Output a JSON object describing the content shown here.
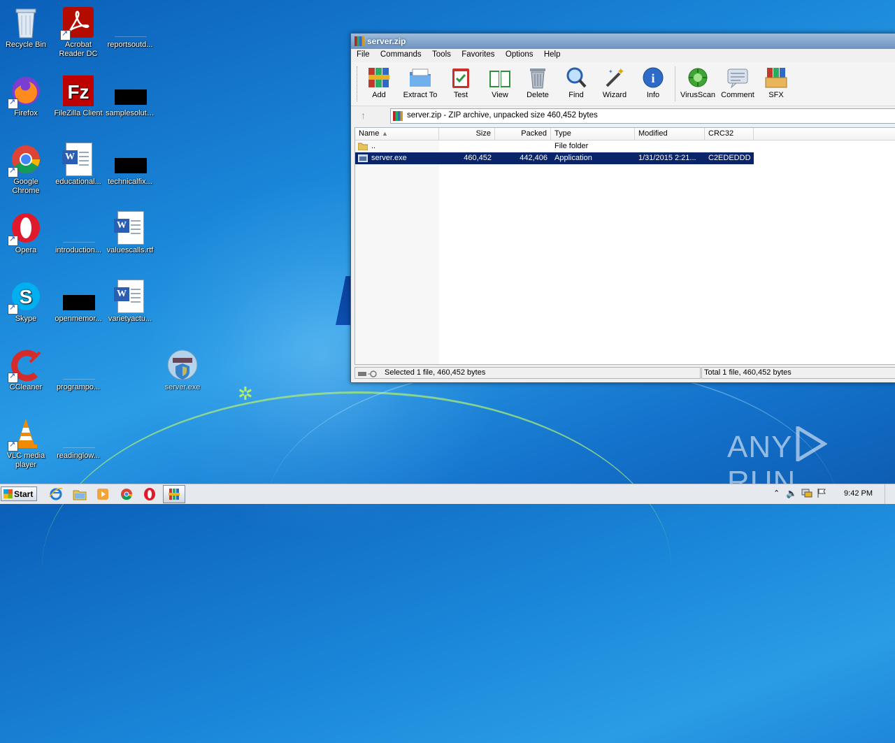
{
  "desktop": {
    "icons": [
      {
        "label": "Recycle Bin"
      },
      {
        "label": "Acrobat Reader DC"
      },
      {
        "label": "reportsoutd..."
      },
      {
        "label": "Firefox"
      },
      {
        "label": "FileZilla Client"
      },
      {
        "label": "samplesoluti..."
      },
      {
        "label": "Google Chrome"
      },
      {
        "label": "educational..."
      },
      {
        "label": "technicalfix..."
      },
      {
        "label": "Opera"
      },
      {
        "label": "introduction..."
      },
      {
        "label": "valuescalls.rtf"
      },
      {
        "label": "Skype"
      },
      {
        "label": "openmemor..."
      },
      {
        "label": "varietyactu..."
      },
      {
        "label": "CCleaner"
      },
      {
        "label": "programpo..."
      },
      {
        "label": "server.exe"
      },
      {
        "label": "VLC media player"
      },
      {
        "label": "readinglow..."
      }
    ]
  },
  "window": {
    "title": "server.zip",
    "menu": [
      "File",
      "Commands",
      "Tools",
      "Favorites",
      "Options",
      "Help"
    ],
    "toolbar": [
      {
        "label": "Add",
        "icon": "add-archive-icon"
      },
      {
        "label": "Extract To",
        "icon": "extract-folder-icon"
      },
      {
        "label": "Test",
        "icon": "test-clipboard-icon"
      },
      {
        "label": "View",
        "icon": "view-book-icon"
      },
      {
        "label": "Delete",
        "icon": "trash-icon"
      },
      {
        "label": "Find",
        "icon": "magnifier-icon"
      },
      {
        "label": "Wizard",
        "icon": "magic-wand-icon"
      },
      {
        "label": "Info",
        "icon": "info-icon"
      },
      {
        "label": "VirusScan",
        "icon": "virus-scan-icon"
      },
      {
        "label": "Comment",
        "icon": "comment-icon"
      },
      {
        "label": "SFX",
        "icon": "sfx-archive-icon"
      }
    ],
    "address": "server.zip - ZIP archive, unpacked size 460,452 bytes",
    "columns": [
      "Name",
      "Size",
      "Packed",
      "Type",
      "Modified",
      "CRC32"
    ],
    "rows": [
      {
        "name": "..",
        "size": "",
        "packed": "",
        "type": "File folder",
        "modified": "",
        "crc": ""
      },
      {
        "name": "server.exe",
        "size": "460,452",
        "packed": "442,406",
        "type": "Application",
        "modified": "1/31/2015 2:21...",
        "crc": "C2EDEDDD"
      }
    ],
    "status_left": "Selected 1 file, 460,452 bytes",
    "status_right": "Total 1 file, 460,452 bytes"
  },
  "taskbar": {
    "start_label": "Start",
    "clock": "9:42 PM"
  },
  "watermark": {
    "left": "ANY",
    "right": "RUN"
  }
}
